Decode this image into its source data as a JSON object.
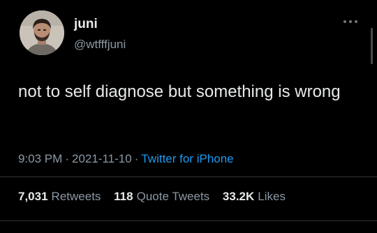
{
  "user": {
    "display_name": "juni",
    "handle": "@wtfffjuni"
  },
  "tweet": {
    "text": "not to self diagnose but something is wrong",
    "time": "9:03 PM",
    "date": "2021-11-10",
    "separator": "·",
    "source": "Twitter for iPhone"
  },
  "stats": {
    "retweets": {
      "count": "7,031",
      "label": "Retweets"
    },
    "quote_tweets": {
      "count": "118",
      "label": "Quote Tweets"
    },
    "likes": {
      "count": "33.2K",
      "label": "Likes"
    }
  },
  "icons": {
    "more": "more-horizontal-icon",
    "avatar": "user-avatar"
  },
  "colors": {
    "background": "#000000",
    "text_primary": "#e7e9ea",
    "text_secondary": "#8b98a5",
    "link": "#1d9bf0"
  }
}
